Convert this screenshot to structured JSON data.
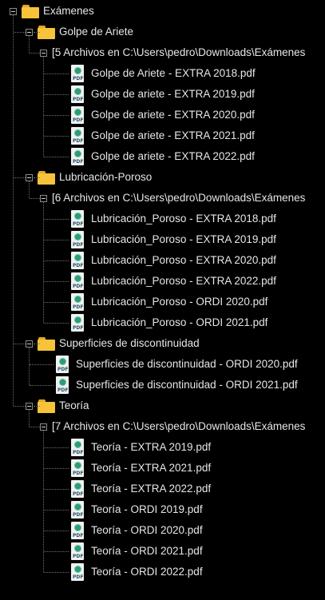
{
  "root": {
    "label": "Exámenes"
  },
  "folders": [
    {
      "label": "Golpe de Ariete",
      "summary": "[5 Archivos en C:\\Users\\pedro\\Downloads\\Exámenes",
      "files": [
        "Golpe de Ariete - EXTRA 2018.pdf",
        "Golpe de ariete - EXTRA 2019.pdf",
        "Golpe de ariete - EXTRA 2020.pdf",
        "Golpe de ariete - EXTRA 2021.pdf",
        "Golpe de ariete - EXTRA 2022.pdf"
      ]
    },
    {
      "label": "Lubricación-Poroso",
      "summary": "[6 Archivos en C:\\Users\\pedro\\Downloads\\Exámenes",
      "files": [
        "Lubricación_Poroso - EXTRA 2018.pdf",
        "Lubricación_Poroso - EXTRA 2019.pdf",
        "Lubricación_Poroso - EXTRA 2020.pdf",
        "Lubricación_Poroso - EXTRA 2022.pdf",
        "Lubricación_Poroso - ORDI 2020.pdf",
        "Lubricación_Poroso - ORDI 2021.pdf"
      ]
    },
    {
      "label": "Superficies de discontinuidad",
      "summary": "",
      "files": [
        "Superficies de discontinuidad - ORDI 2020.pdf",
        "Superficies de discontinuidad - ORDI 2021.pdf"
      ]
    },
    {
      "label": "Teoría",
      "summary": "[7 Archivos en C:\\Users\\pedro\\Downloads\\Exámenes",
      "files": [
        "Teoría - EXTRA 2019.pdf",
        "Teoría - EXTRA 2021.pdf",
        "Teoría - EXTRA 2022.pdf",
        "Teoría - ORDI 2019.pdf",
        "Teoría - ORDI 2020.pdf",
        "Teoría - ORDI 2021.pdf",
        "Teoría - ORDI 2022.pdf"
      ]
    }
  ],
  "icons": {
    "folder": "folder-icon",
    "pdf": "pdf-file-icon",
    "pdf_tag": "PDF",
    "expander": "collapse-toggle-icon"
  },
  "colors": {
    "background": "#000000",
    "text": "#e6e6e6",
    "folder": "#f7c33b",
    "pdf_logo": "#2e9a78",
    "tree_lines": "#6e6e6e"
  }
}
